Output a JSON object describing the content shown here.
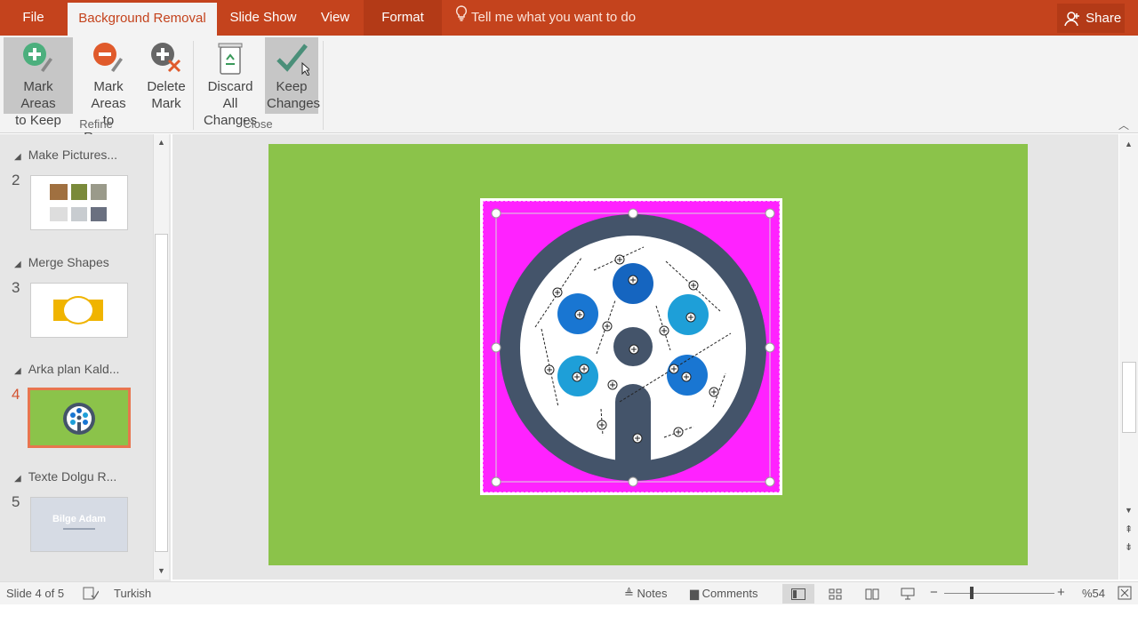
{
  "tabs": [
    {
      "label": "File"
    },
    {
      "label": "Background Removal"
    },
    {
      "label": "Slide Show"
    },
    {
      "label": "View"
    },
    {
      "label": "Format"
    }
  ],
  "tell_me": "Tell me what you want to do",
  "share_label": "Share",
  "ribbon": {
    "refine_group": "Refine",
    "close_group": "Close",
    "mark_keep": [
      "Mark Areas",
      "to Keep"
    ],
    "mark_remove": [
      "Mark Areas",
      "to Remove"
    ],
    "delete_mark": [
      "Delete",
      "Mark"
    ],
    "discard_all": [
      "Discard All",
      "Changes"
    ],
    "keep_changes": [
      "Keep",
      "Changes"
    ]
  },
  "slides": {
    "sections": [
      "Make Pictures...",
      "Merge Shapes",
      "Arka plan Kald...",
      "Texte Dolgu R..."
    ],
    "numbers": [
      "2",
      "3",
      "4",
      "5"
    ],
    "thumb5_title": "Bilge Adam",
    "current": "4"
  },
  "status": {
    "slide_info": "Slide 4 of 5",
    "language": "Turkish",
    "notes": "Notes",
    "comments": "Comments",
    "zoom": "%54"
  },
  "colors": {
    "accent": "#c4431d",
    "slide_bg": "#8bc34a",
    "removal_overlay": "#ff22ff",
    "ring": "#44546a",
    "blue_dark": "#1565c0",
    "blue_mid": "#1976d2",
    "blue_light": "#1e9fd8"
  },
  "icons": {
    "mark_keep": "plus-pencil-icon",
    "mark_remove": "minus-pencil-icon",
    "delete_mark": "delete-mark-icon",
    "discard_all": "recycle-bin-icon",
    "keep_changes": "checkmark-icon"
  }
}
